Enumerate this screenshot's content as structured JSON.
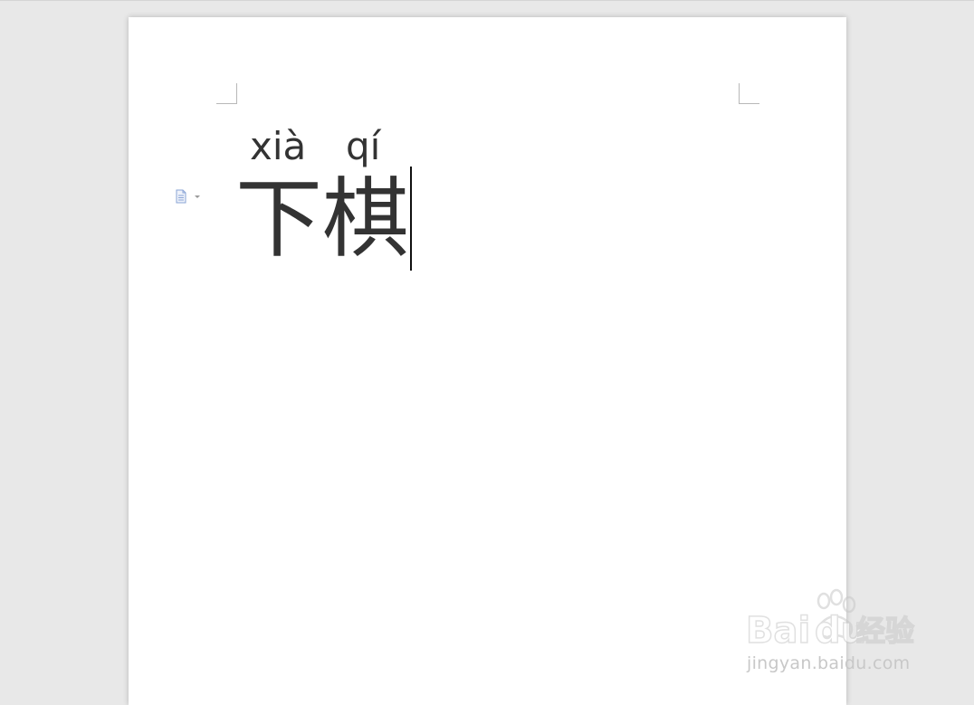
{
  "document": {
    "ruby": [
      {
        "pinyin": "xià",
        "hanzi": "下"
      },
      {
        "pinyin": "qí",
        "hanzi": "棋"
      }
    ]
  },
  "watermark": {
    "brand_latin": "Bai",
    "brand_latin_tail": "du",
    "brand_cn": "经验",
    "url": "jingyan.baidu.com"
  },
  "icons": {
    "paragraph_marker": "document-icon",
    "paragraph_dropdown": "chevron-down-icon",
    "watermark_logo": "paw-print-icon"
  },
  "colors": {
    "workspace": "#e8e8e8",
    "page": "#ffffff",
    "text": "#333333",
    "marker": "#8aa4d6",
    "watermark": "#c8c8c8"
  }
}
